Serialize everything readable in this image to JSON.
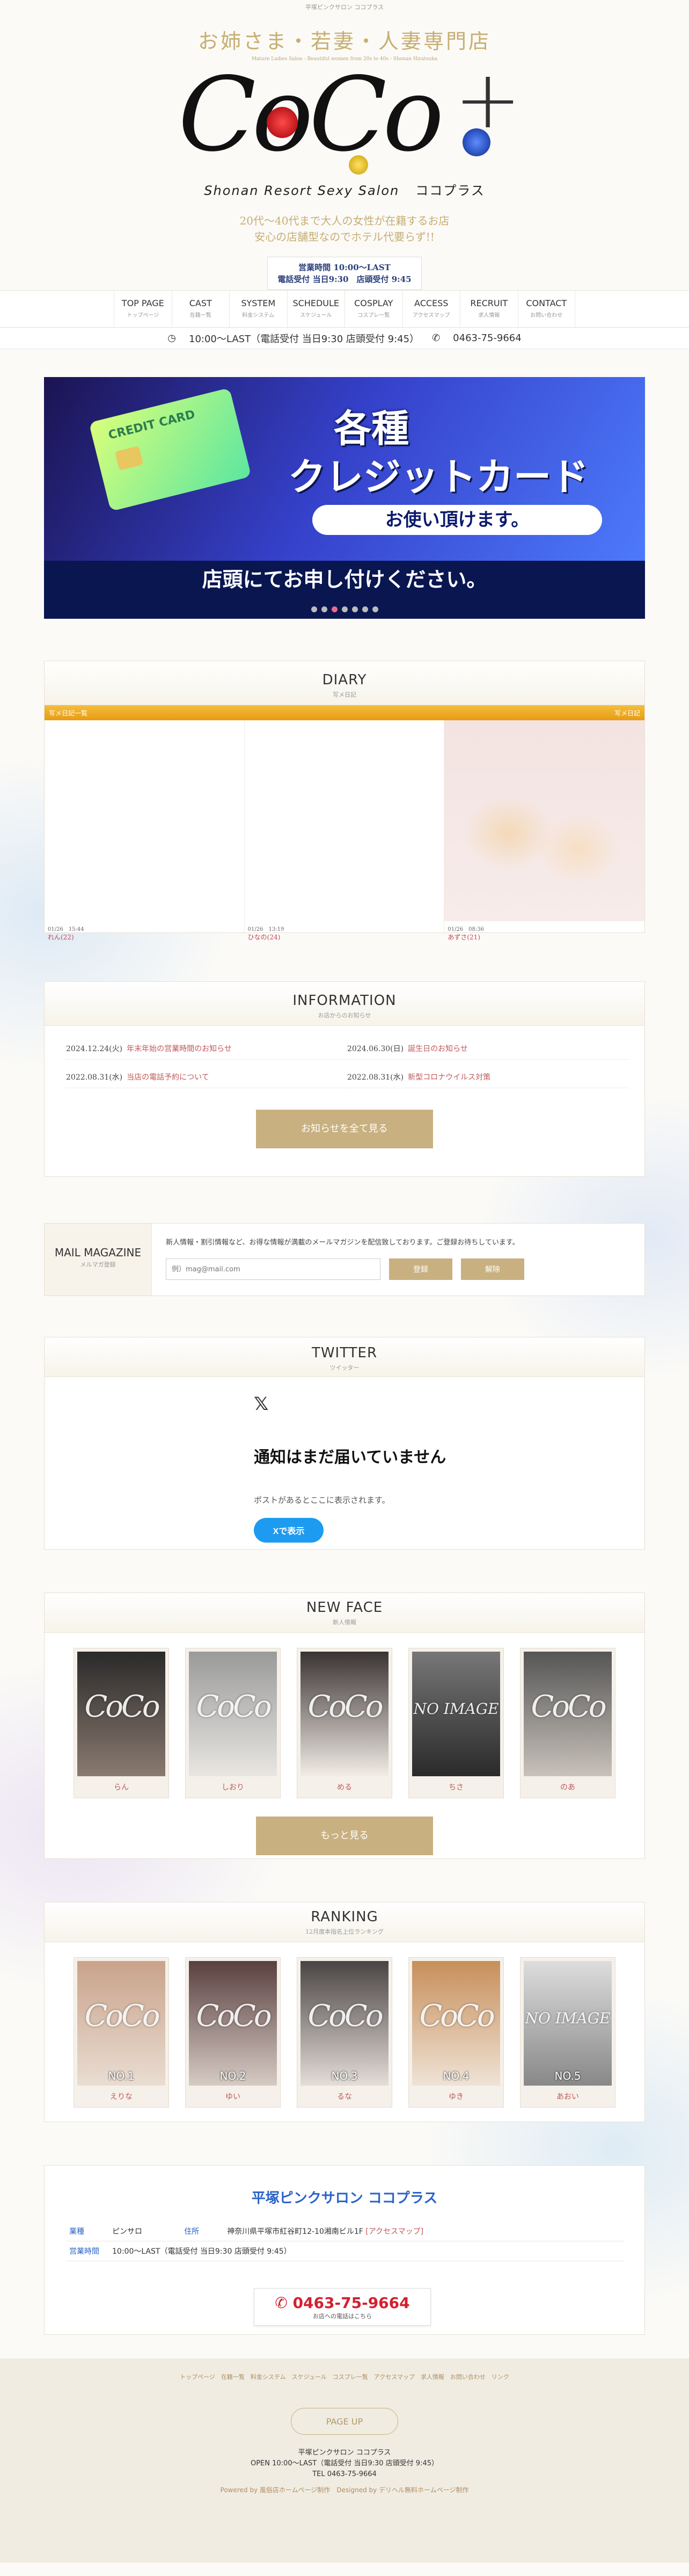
{
  "header": {
    "tagline": "平塚ピンクサロン ココプラス",
    "catch": "お姉さま・若妻・人妻専門店",
    "catch_en": "Mature Ladies Salon - Beautiful women from 20s to 40s - Shonan Hiratsuka",
    "logo_text": "CoCo",
    "logo_sub": "Shonan Resort Sexy Salon",
    "logo_kana": "ココプラス",
    "catch2_line1": "20代～40代まで大人の女性が在籍するお店",
    "catch2_line2": "安心の店舗型なのでホテル代要らず!!",
    "hours_line1": "営業時間 10:00～LAST",
    "hours_line2": "電話受付 当日9:30　店頭受付 9:45"
  },
  "nav": [
    {
      "en": "TOP PAGE",
      "jp": "トップページ"
    },
    {
      "en": "CAST",
      "jp": "在籍一覧"
    },
    {
      "en": "SYSTEM",
      "jp": "料金システム"
    },
    {
      "en": "SCHEDULE",
      "jp": "スケジュール"
    },
    {
      "en": "COSPLAY",
      "jp": "コスプレ一覧"
    },
    {
      "en": "ACCESS",
      "jp": "アクセスマップ"
    },
    {
      "en": "RECRUIT",
      "jp": "求人情報"
    },
    {
      "en": "CONTACT",
      "jp": "お問い合わせ"
    }
  ],
  "infobar": {
    "hours": "10:00～LAST（電話受付 当日9:30 店頭受付 9:45）",
    "phone": "0463-75-9664"
  },
  "banner": {
    "card": "CREDIT CARD",
    "h1": "各種",
    "h2": "クレジットカード",
    "pill": "お使い頂けます。",
    "strip": "店頭にてお申し付けください。"
  },
  "diary": {
    "title": "DIARY",
    "sub": "写メ日記",
    "bar_left": "写メ日記一覧",
    "bar_right": "写メ日記",
    "items": [
      {
        "date": "01/26　15:44",
        "name": "れん(22)"
      },
      {
        "date": "01/26　13:19",
        "name": "ひなの(24)"
      },
      {
        "date": "01/26　08:36",
        "name": "あずさ(21)"
      }
    ]
  },
  "information": {
    "title": "INFORMATION",
    "sub": "お店からのお知らせ",
    "items": [
      {
        "date": "2024.12.24(火)",
        "text": "年末年始の営業時間のお知らせ"
      },
      {
        "date": "2024.06.30(日)",
        "text": "誕生日のお知らせ"
      },
      {
        "date": "2022.08.31(水)",
        "text": "当店の電話予約について"
      },
      {
        "date": "2022.08.31(水)",
        "text": "新型コロナウイルス対策"
      }
    ],
    "button": "お知らせを全て見る"
  },
  "mail": {
    "title": "MAIL MAGAZINE",
    "sub": "メルマガ登録",
    "desc": "新人情報・割引情報など、お得な情報が満載のメールマガジンを配信致しております。ご登録お待ちしています。",
    "placeholder": "例）mag@mail.com",
    "btn_register": "登録",
    "btn_cancel": "解除"
  },
  "twitter": {
    "title": "TWITTER",
    "sub": "ツイッター",
    "heading": "通知はまだ届いていません",
    "text": "ポストがあるとここに表示されます。",
    "button": "Xで表示"
  },
  "newface": {
    "title": "NEW FACE",
    "sub": "新人情報",
    "button": "もっと見る",
    "items": [
      {
        "name": "らん"
      },
      {
        "name": "しおり"
      },
      {
        "name": "める"
      },
      {
        "name": "ちさ"
      },
      {
        "name": "のあ"
      }
    ]
  },
  "ranking": {
    "title": "RANKING",
    "sub": "12月度本指名上位ランキング",
    "items": [
      {
        "rank": "NO.1",
        "name": "えりな"
      },
      {
        "rank": "NO.2",
        "name": "ゆい"
      },
      {
        "rank": "NO.3",
        "name": "るな"
      },
      {
        "rank": "NO.4",
        "name": "ゆき"
      },
      {
        "rank": "NO.5",
        "name": "あおい"
      }
    ]
  },
  "shop": {
    "title": "平塚ピンクサロン ココプラス",
    "k1": "業種",
    "v1": "ピンサロ",
    "k2": "住所",
    "v2": "神奈川県平塚市紅谷町12-10湘南ビル1F",
    "k2link": "[アクセスマップ]",
    "k3": "営業時間",
    "v3": "10:00～LAST（電話受付 当日9:30 店頭受付 9:45）",
    "phone": "0463-75-9664",
    "phone_sub": "お店への電話はこちら"
  },
  "footer": {
    "links": "トップページ　在籍一覧　料金システム　スケジュール　コスプレ一覧　アクセスマップ　求人情報　お問い合わせ　リンク",
    "top": "PAGE UP",
    "name": "平塚ピンクサロン ココプラス",
    "open": "OPEN 10:00～LAST（電話受付 当日9:30 店頭受付 9:45）",
    "tel": "TEL 0463-75-9664",
    "powered": "Powered by 風俗店ホームページ制作　Designed by デリヘル無料ホームページ制作"
  }
}
